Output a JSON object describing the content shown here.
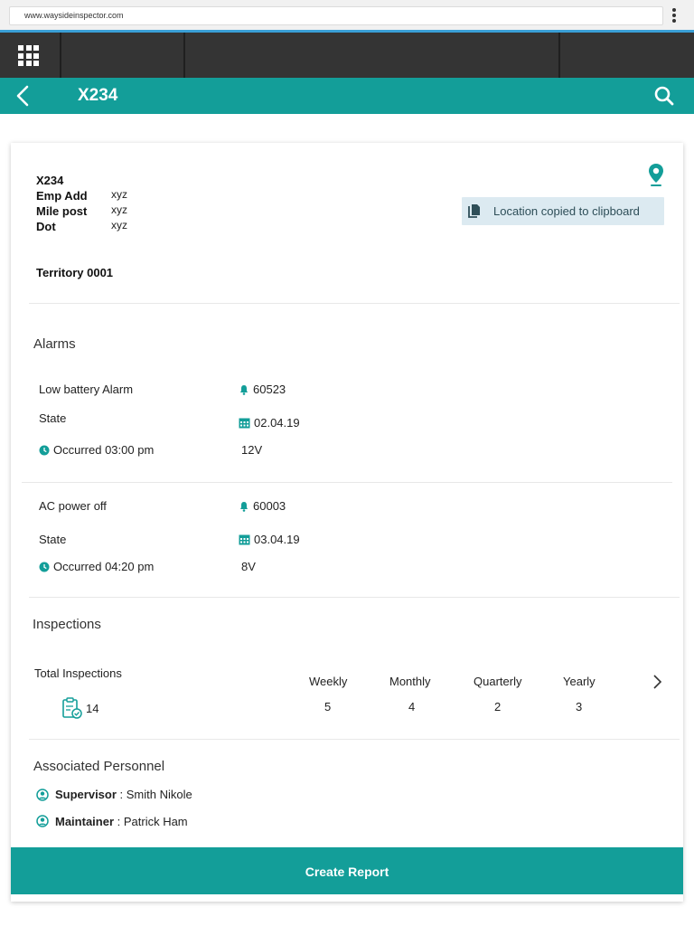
{
  "browser": {
    "url": "www.waysideinspector.com"
  },
  "header": {
    "title": "X234"
  },
  "asset": {
    "id": "X234",
    "fields": [
      {
        "label": "Emp Add",
        "value": "xyz"
      },
      {
        "label": "Mile post",
        "value": "xyz"
      },
      {
        "label": "Dot",
        "value": "xyz"
      }
    ],
    "territory": "Territory 0001",
    "clipboard_notice": "Location copied to clipboard"
  },
  "alarms": {
    "title": "Alarms",
    "items": [
      {
        "name": "Low battery Alarm",
        "code": "60523",
        "state_label": "State",
        "date": "02.04.19",
        "occurred": "Occurred 03:00 pm",
        "voltage": "12V"
      },
      {
        "name": "AC power off",
        "code": "60003",
        "state_label": "State",
        "date": "03.04.19",
        "occurred": "Occurred 04:20 pm",
        "voltage": "8V"
      }
    ]
  },
  "inspections": {
    "title": "Inspections",
    "total_label": "Total Inspections",
    "total": "14",
    "periods": [
      {
        "label": "Weekly",
        "value": "5"
      },
      {
        "label": "Monthly",
        "value": "4"
      },
      {
        "label": "Quarterly",
        "value": "2"
      },
      {
        "label": "Yearly",
        "value": "3"
      }
    ]
  },
  "personnel": {
    "title": "Associated Personnel",
    "items": [
      {
        "role": "Supervisor",
        "name": " : Smith Nikole"
      },
      {
        "role": "Maintainer",
        "name": " : Patrick Ham"
      }
    ]
  },
  "actions": {
    "create_report": "Create Report"
  },
  "colors": {
    "teal": "#139e99",
    "nav_dark": "#343434",
    "accent_blue": "#3a9fd6",
    "badge_bg": "#dceaf1"
  }
}
